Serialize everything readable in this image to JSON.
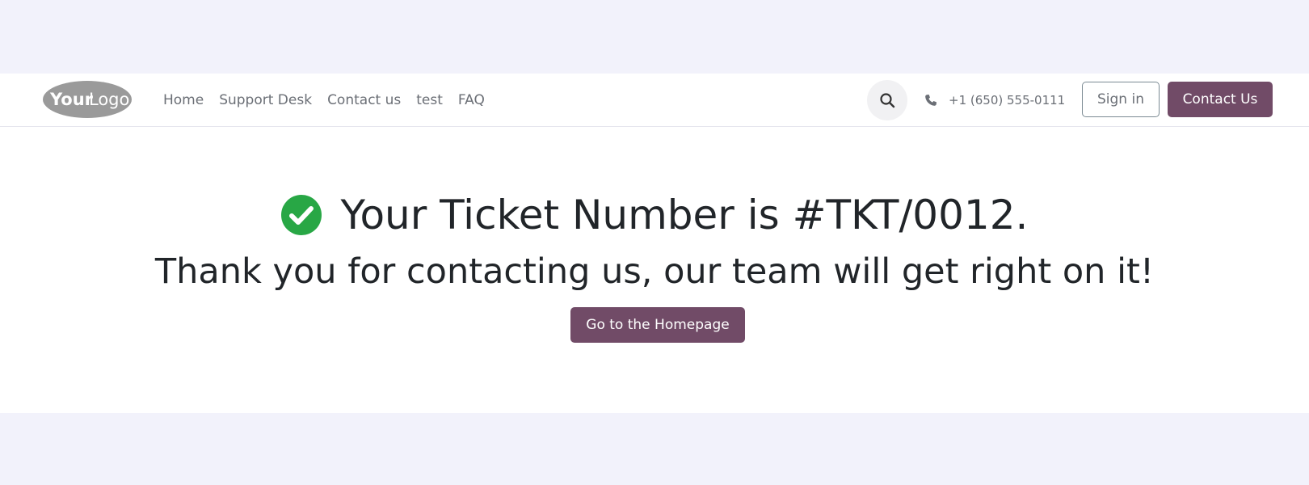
{
  "header": {
    "logo_text_bold": "Your",
    "logo_text_light": "Logo",
    "nav": [
      {
        "label": "Home"
      },
      {
        "label": "Support Desk"
      },
      {
        "label": "Contact us"
      },
      {
        "label": "test"
      },
      {
        "label": "FAQ"
      }
    ],
    "search_icon": "search-icon",
    "phone_icon": "phone-icon",
    "phone": "+1 (650) 555-0111",
    "sign_in_label": "Sign in",
    "contact_label": "Contact Us"
  },
  "main": {
    "check_icon": "check-circle-icon",
    "ticket_message": "Your Ticket Number is #TKT/0012.",
    "thanks_message": "Thank you for contacting us, our team will get right on it!",
    "home_button_label": "Go to the Homepage"
  },
  "colors": {
    "page_background": "#f2f2fb",
    "primary": "#714b67",
    "success": "#28a745",
    "text": "#212529",
    "muted_text": "#6b6f76"
  }
}
